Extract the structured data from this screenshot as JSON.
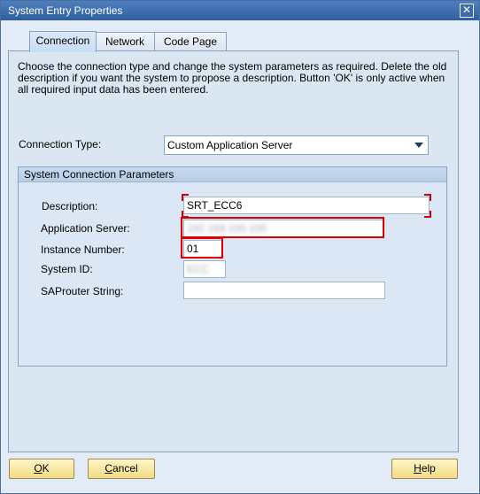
{
  "window": {
    "title": "System Entry Properties",
    "close_symbol": "✕"
  },
  "tabs": [
    {
      "label": "Connection",
      "active": true
    },
    {
      "label": "Network",
      "active": false
    },
    {
      "label": "Code Page",
      "active": false
    }
  ],
  "instructions": "Choose the connection type and change the system parameters as required. Delete the old description if you want the system to propose a description. Button 'OK' is only active when all required input data has been entered.",
  "connection_type": {
    "label": "Connection Type:",
    "value": "Custom Application Server"
  },
  "group": {
    "title": "System Connection Parameters",
    "fields": {
      "description": {
        "label": "Description:",
        "value": "SRT_ECC6"
      },
      "application_server": {
        "label": "Application Server:",
        "value": "192.168.100.100"
      },
      "instance_number": {
        "label": "Instance Number:",
        "value": "01"
      },
      "system_id": {
        "label": "System ID:",
        "value": "ECC"
      },
      "saprouter": {
        "label": "SAProuter String:",
        "value": ""
      }
    }
  },
  "buttons": {
    "ok": {
      "mnemonic": "O",
      "rest": "K"
    },
    "cancel": {
      "mnemonic": "C",
      "rest": "ancel"
    },
    "help": {
      "mnemonic": "H",
      "rest": "elp"
    }
  },
  "colors": {
    "highlight": "#e00000",
    "button": "#f2dc84"
  }
}
